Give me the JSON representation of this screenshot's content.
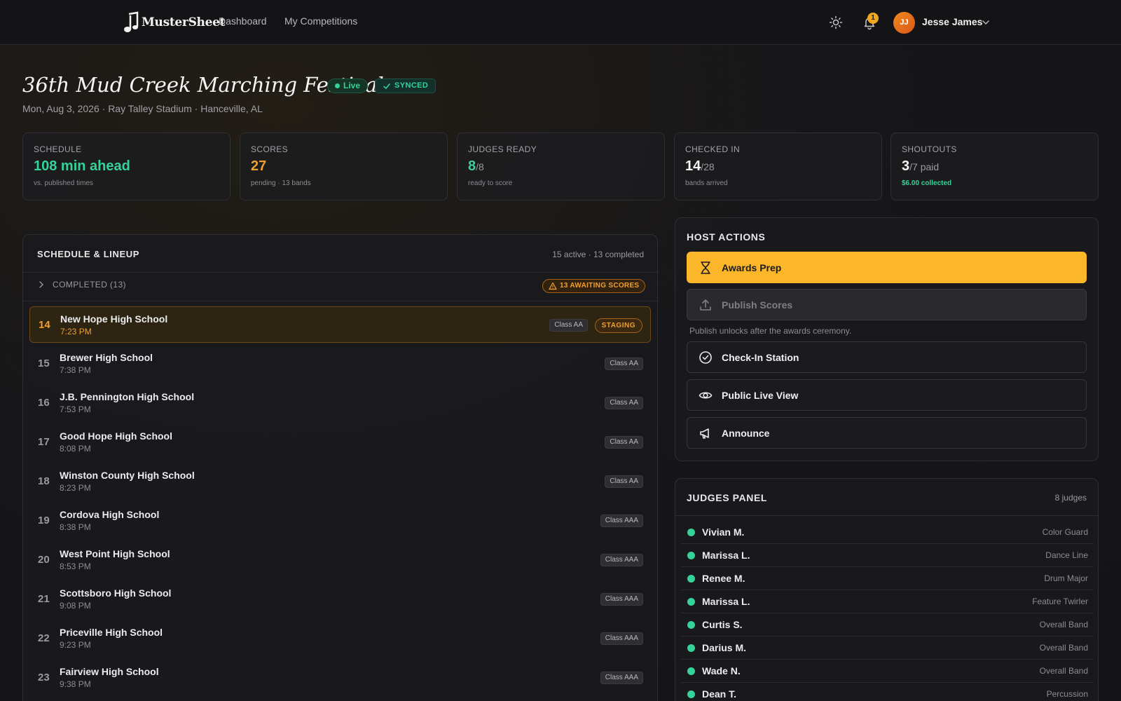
{
  "app": {
    "logo_text": "MusterSheet"
  },
  "nav": {
    "dashboard": "Dashboard",
    "competitions": "My Competitions"
  },
  "user": {
    "initials": "JJ",
    "name": "Jesse James",
    "notifications": "1"
  },
  "event": {
    "title": "36th Mud Creek Marching Festival",
    "live_label": "Live",
    "sync_label": "SYNCED",
    "subtitle": "Mon, Aug 3, 2026 · Ray Talley Stadium · Hanceville, AL"
  },
  "stats": [
    {
      "label": "SCHEDULE",
      "value": "108 min ahead",
      "suffix": "",
      "sub": "vs. published times",
      "color": "#34d399"
    },
    {
      "label": "SCORES",
      "value": "27",
      "suffix": "",
      "sub": "pending · 13 bands",
      "color": "#f0a030"
    },
    {
      "label": "JUDGES READY",
      "value": "8",
      "suffix": "/8",
      "sub": "ready to score",
      "color": "#34d399"
    },
    {
      "label": "CHECKED IN",
      "value": "14",
      "suffix": "/28",
      "sub": "bands arrived",
      "color": "#f5f5f5"
    },
    {
      "label": "SHOUTOUTS",
      "value": "3",
      "suffix": "/7 paid",
      "sub": "$6.00 collected",
      "color": "#f5f5f5",
      "sub_color": "#34d399"
    }
  ],
  "schedule": {
    "title": "SCHEDULE & LINEUP",
    "meta": "15 active · 13 completed",
    "completed_label": "COMPLETED (13)",
    "awaiting_label": "13 AWAITING SCORES",
    "rows": [
      {
        "num": "14",
        "name": "New Hope High School",
        "time": "7:23 PM",
        "class": "Class AA",
        "status": "STAGING",
        "active": true
      },
      {
        "num": "15",
        "name": "Brewer High School",
        "time": "7:38 PM",
        "class": "Class AA"
      },
      {
        "num": "16",
        "name": "J.B. Pennington High School",
        "time": "7:53 PM",
        "class": "Class AA"
      },
      {
        "num": "17",
        "name": "Good Hope High School",
        "time": "8:08 PM",
        "class": "Class AA"
      },
      {
        "num": "18",
        "name": "Winston County High School",
        "time": "8:23 PM",
        "class": "Class AA"
      },
      {
        "num": "19",
        "name": "Cordova High School",
        "time": "8:38 PM",
        "class": "Class AAA"
      },
      {
        "num": "20",
        "name": "West Point High School",
        "time": "8:53 PM",
        "class": "Class AAA"
      },
      {
        "num": "21",
        "name": "Scottsboro High School",
        "time": "9:08 PM",
        "class": "Class AAA"
      },
      {
        "num": "22",
        "name": "Priceville High School",
        "time": "9:23 PM",
        "class": "Class AAA"
      },
      {
        "num": "23",
        "name": "Fairview High School",
        "time": "9:38 PM",
        "class": "Class AAA"
      }
    ]
  },
  "host": {
    "title": "HOST ACTIONS",
    "awards": "Awards Prep",
    "publish": "Publish Scores",
    "publish_note": "Publish unlocks after the awards ceremony.",
    "checkin": "Check-In Station",
    "public_view": "Public Live View",
    "announce": "Announce"
  },
  "judges": {
    "title": "JUDGES PANEL",
    "count": "8 judges",
    "list": [
      {
        "name": "Vivian M.",
        "caption": "Color Guard"
      },
      {
        "name": "Marissa L.",
        "caption": "Dance Line"
      },
      {
        "name": "Renee M.",
        "caption": "Drum Major"
      },
      {
        "name": "Marissa L.",
        "caption": "Feature Twirler"
      },
      {
        "name": "Curtis S.",
        "caption": "Overall Band"
      },
      {
        "name": "Darius M.",
        "caption": "Overall Band"
      },
      {
        "name": "Wade N.",
        "caption": "Overall Band"
      },
      {
        "name": "Dean T.",
        "caption": "Percussion"
      }
    ]
  }
}
